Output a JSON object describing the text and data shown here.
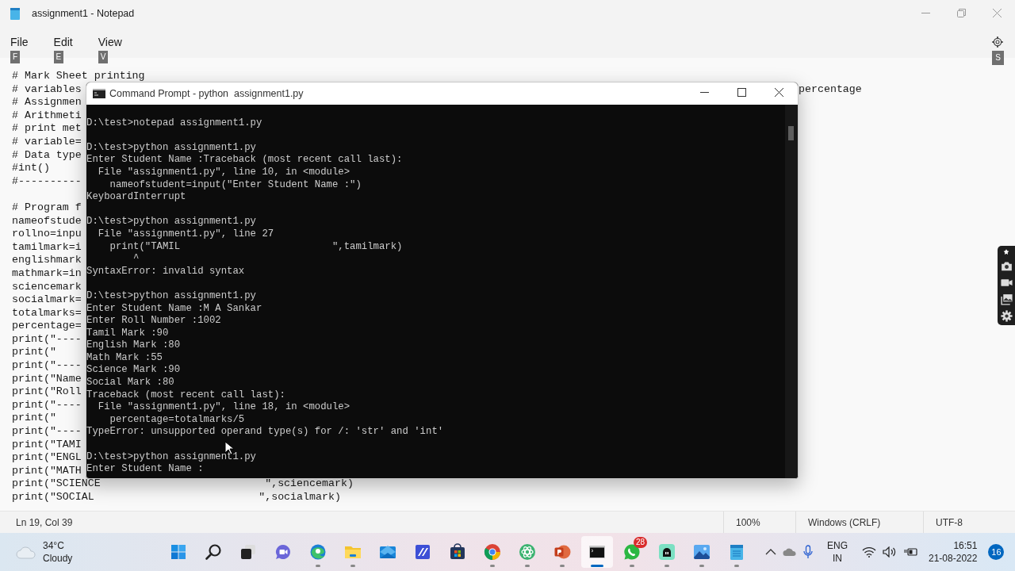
{
  "notepad": {
    "title": "assignment1 - Notepad",
    "menu": [
      {
        "label": "File",
        "keytip": "F"
      },
      {
        "label": "Edit",
        "keytip": "E"
      },
      {
        "label": "View",
        "keytip": "V"
      }
    ],
    "settings_keytip": "S",
    "editor": {
      "blocks": [
        [
          {
            "text": "# Mark Sheet printing"
          },
          {
            "text": "# variables",
            "tail": "percentage"
          },
          {
            "text": "# Assignmen"
          },
          {
            "text": "# Arithmeti"
          },
          {
            "text": "# print met"
          },
          {
            "text": "# variable="
          },
          {
            "text": "# Data type"
          },
          {
            "text": "#int()"
          },
          {
            "text": "#----------"
          }
        ],
        [
          {
            "text": "# Program f"
          },
          {
            "text": "nameofstude"
          },
          {
            "text": "rollno=inpu"
          },
          {
            "text": "tamilmark=i"
          },
          {
            "text": "englishmark"
          },
          {
            "text": "mathmark=in"
          },
          {
            "text": "sciencemark"
          },
          {
            "text": "socialmark="
          },
          {
            "text": "totalmarks="
          },
          {
            "text": "percentage="
          },
          {
            "text": "print(\"----"
          },
          {
            "text": "print(\""
          },
          {
            "text": "print(\"----"
          },
          {
            "text": "print(\"Name"
          },
          {
            "text": "print(\"Roll"
          },
          {
            "text": "print(\"----"
          },
          {
            "text": "print(\""
          },
          {
            "text": "print(\"----"
          },
          {
            "text": "print(\"TAMI"
          },
          {
            "text": "print(\"ENGL"
          },
          {
            "text": "print(\"MATH"
          },
          {
            "text": "print(\"SCIENCE                          \",sciencemark)"
          },
          {
            "text": "print(\"SOCIAL                          \",socialmark)"
          }
        ]
      ]
    },
    "status_bar": {
      "position": "Ln 19, Col 39",
      "zoom": "100%",
      "line_ending": "Windows (CRLF)",
      "encoding": "UTF-8"
    }
  },
  "command_prompt": {
    "title": "Command Prompt - python  assignment1.py",
    "blocks": [
      [
        "D:\\test>notepad assignment1.py"
      ],
      [
        "D:\\test>python assignment1.py",
        "Enter Student Name :Traceback (most recent call last):",
        "  File \"assignment1.py\", line 10, in <module>",
        "    nameofstudent=input(\"Enter Student Name :\")",
        "KeyboardInterrupt"
      ],
      [
        "D:\\test>python assignment1.py",
        "  File \"assignment1.py\", line 27",
        "    print(\"TAMIL                          \",tamilmark)",
        "        ^",
        "SyntaxError: invalid syntax"
      ],
      [
        "D:\\test>python assignment1.py",
        "Enter Student Name :M A Sankar",
        "Enter Roll Number :1002",
        "Tamil Mark :90",
        "English Mark :80",
        "Math Mark :55",
        "Science Mark :90",
        "Social Mark :80",
        "Traceback (most recent call last):",
        "  File \"assignment1.py\", line 18, in <module>",
        "    percentage=totalmarks/5",
        "TypeError: unsupported operand type(s) for /: 'str' and 'int'"
      ],
      [
        "D:\\test>python assignment1.py",
        "Enter Student Name :"
      ]
    ]
  },
  "recorder_toolbar": {
    "tools": [
      {
        "kind": "pin"
      },
      {
        "kind": "camera"
      },
      {
        "kind": "video"
      },
      {
        "kind": "gallery"
      },
      {
        "kind": "settings"
      }
    ]
  },
  "taskbar": {
    "weather": {
      "temperature": "34°C",
      "condition": "Cloudy"
    },
    "apps": [
      {
        "kind": "start",
        "running": false,
        "active": false
      },
      {
        "kind": "search",
        "running": false,
        "active": false
      },
      {
        "kind": "taskview",
        "running": false,
        "active": false
      },
      {
        "kind": "chat",
        "running": false,
        "active": false
      },
      {
        "kind": "edge",
        "running": true,
        "active": false
      },
      {
        "kind": "explorer",
        "running": true,
        "active": false
      },
      {
        "kind": "mail",
        "running": false,
        "active": false
      },
      {
        "kind": "pen",
        "running": false,
        "active": false
      },
      {
        "kind": "store",
        "running": false,
        "active": false
      },
      {
        "kind": "chrome",
        "running": true,
        "active": false
      },
      {
        "kind": "atom",
        "running": true,
        "active": false
      },
      {
        "kind": "powerpoint",
        "running": true,
        "active": false
      },
      {
        "kind": "terminal",
        "running": true,
        "active": true
      },
      {
        "kind": "whatsapp",
        "running": true,
        "active": false,
        "badge": "28"
      },
      {
        "kind": "robot",
        "running": true,
        "active": false
      },
      {
        "kind": "photos",
        "running": true,
        "active": false
      },
      {
        "kind": "notepad",
        "running": true,
        "active": false
      }
    ],
    "tray": {
      "language": "ENG",
      "region": "IN",
      "time": "16:51",
      "date": "21-08-2022",
      "notifications": "16"
    }
  }
}
